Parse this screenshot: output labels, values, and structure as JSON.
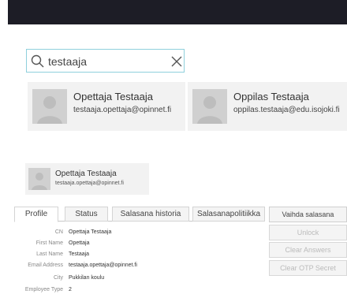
{
  "search": {
    "value": "testaaja",
    "placeholder": ""
  },
  "results": [
    {
      "name": "Opettaja Testaaja",
      "email": "testaaja.opettaja@opinnet.fi"
    },
    {
      "name": "Oppilas Testaaja",
      "email": "oppilas.testaaja@edu.isojoki.fi"
    }
  ],
  "selected_user": {
    "name": "Opettaja Testaaja",
    "email": "testaaja.opettaja@opinnet.fi"
  },
  "tabs": [
    {
      "label": "Profile",
      "active": true
    },
    {
      "label": "Status"
    },
    {
      "label": "Salasana historia"
    },
    {
      "label": "Salasanapolitiikka"
    }
  ],
  "actions": {
    "change_password": "Vaihda salasana",
    "unlock": "Unlock",
    "clear_answers": "Clear Answers",
    "clear_otp": "Clear OTP Secret"
  },
  "profile": [
    {
      "label": "CN",
      "value": "Opettaja Testaaja"
    },
    {
      "label": "First Name",
      "value": "Opettaja"
    },
    {
      "label": "Last Name",
      "value": "Testaaja"
    },
    {
      "label": "Email Address",
      "value": "testaaja.opettaja@opinnet.fi"
    },
    {
      "label": "City",
      "value": "Pukkilan koulu"
    },
    {
      "label": "Employee Type",
      "value": "2"
    }
  ],
  "colors": {
    "topbar": "#1d1d26",
    "search_border": "#8fd0dc",
    "card_bg": "#f2f2f2"
  }
}
